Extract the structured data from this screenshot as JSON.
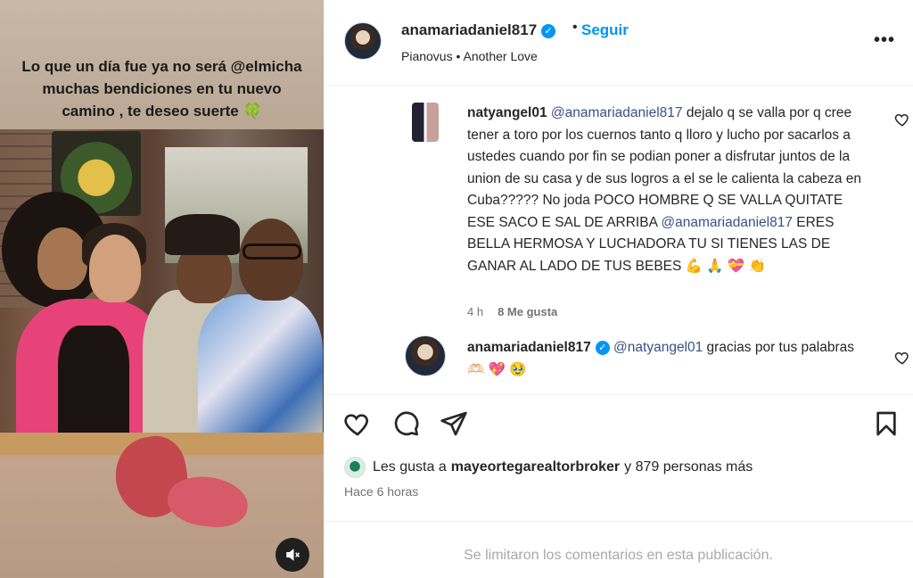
{
  "media": {
    "caption": "Lo que un día fue ya no será @elmicha muchas bendiciones en tu nuevo camino , te deseo suerte 🍀"
  },
  "post": {
    "username": "anamariadaniel817",
    "verified_mark": "✓",
    "follow_label": "Seguir",
    "dot": "•",
    "audio_artist": "Pianovus",
    "audio_sep": " • ",
    "audio_track": "Another Love",
    "more_label": "•••"
  },
  "comments": [
    {
      "username": "natyangel01",
      "mention": "@anamariadaniel817",
      "text_part1": " dejalo q se valla por q cree tener a toro por los cuernos tanto q lloro y lucho por sacarlos a ustedes cuando por fin se podian poner a disfrutar juntos de la union de su casa y de sus logros a el se le calienta la cabeza en Cuba????? No joda POCO HOMBRE Q SE VALLA QUITATE ESE SACO E SAL DE ARRIBA ",
      "mention2": "@anamariadaniel817",
      "text_part2": " ERES BELLA HERMOSA Y LUCHADORA TU SI TIENES LAS DE GANAR AL LADO DE TUS BEBES 💪 🙏 💝 👏",
      "time": "4 h",
      "likes": "8 Me gusta"
    },
    {
      "username": "anamariadaniel817",
      "mention": "@natyangel01",
      "text": " gracias por tus palabras 🫶🏻 💖 🥹"
    }
  ],
  "likes": {
    "prefix": "Les gusta a",
    "user": "mayeortegarealtorbroker",
    "suffix": "y 879 personas más"
  },
  "time_ago": "Hace 6 horas",
  "comments_limited": "Se limitaron los comentarios en esta publicación."
}
